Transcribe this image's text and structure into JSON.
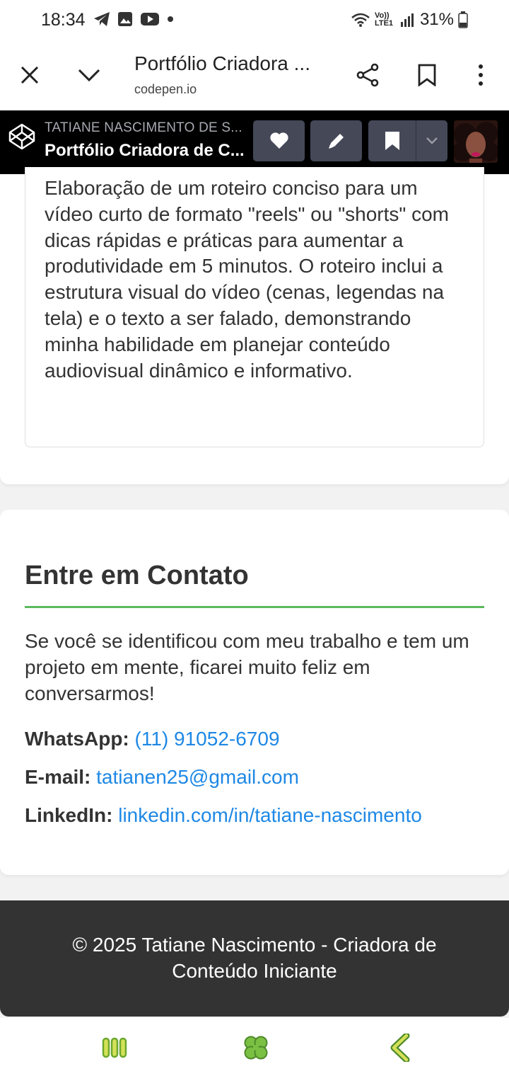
{
  "status_bar": {
    "time": "18:34",
    "battery": "31%",
    "network": "Vo)) LTE1"
  },
  "tab_bar": {
    "title": "Portfólio Criadora ...",
    "url": "codepen.io"
  },
  "codepen": {
    "author": "TATIANE NASCIMENTO DE S...",
    "pen_title": "Portfólio Criadora de C..."
  },
  "project": {
    "description": "Elaboração de um roteiro conciso para um vídeo curto de formato \"reels\" ou \"shorts\" com dicas rápidas e práticas para aumentar a produtividade em 5 minutos. O roteiro inclui a estrutura visual do vídeo (cenas, legendas na tela) e o texto a ser falado, demonstrando minha habilidade em planejar conteúdo audiovisual dinâmico e informativo."
  },
  "contact": {
    "title": "Entre em Contato",
    "intro": "Se você se identificou com meu trabalho e tem um projeto em mente, ficarei muito feliz em conversarmos!",
    "whatsapp_label": "WhatsApp:",
    "whatsapp_value": "(11) 91052-6709",
    "email_label": "E-mail:",
    "email_value": "tatianen25@gmail.com",
    "linkedin_label": "LinkedIn:",
    "linkedin_value": "linkedin.com/in/tatiane-nascimento"
  },
  "footer": {
    "text": "© 2025 Tatiane Nascimento - Criadora de Conteúdo Iniciante"
  },
  "colors": {
    "accent_green": "#5cb85c",
    "link_blue": "#1e88e5",
    "footer_bg": "#333333",
    "nav_icon_green": "#7bc043"
  }
}
